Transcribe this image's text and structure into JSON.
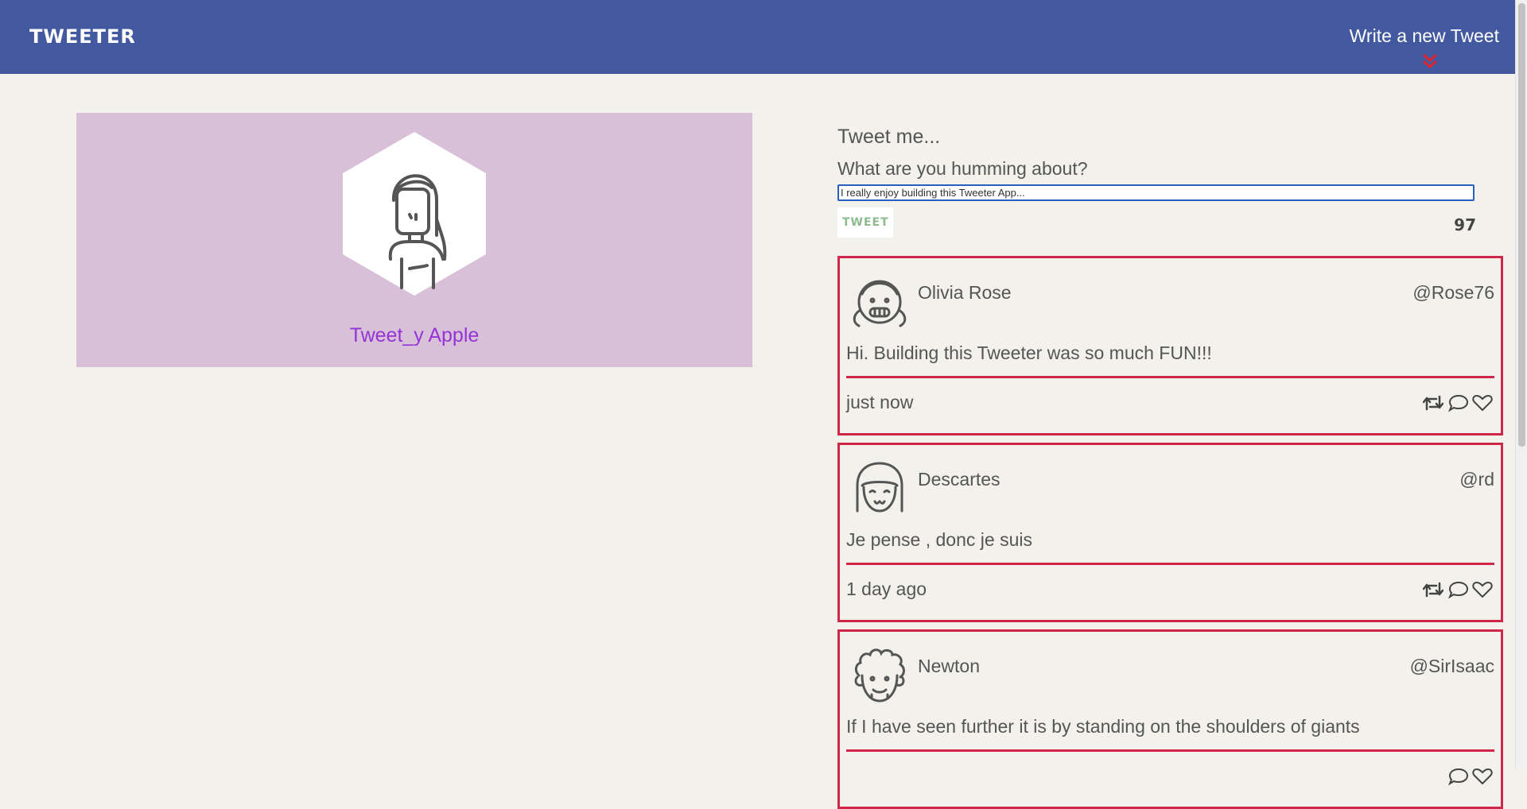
{
  "nav": {
    "brand": "TWEETER",
    "compose_toggle": "Write a new Tweet",
    "compose_toggle_icon": "double-chevron-down-icon",
    "accent_color": "#4259a0",
    "chevron_color": "#e0242f"
  },
  "profile": {
    "name": "Tweet_y Apple",
    "avatar_icon": "woman-avatar-icon",
    "background_color": "#d8c0d8",
    "name_color": "#9533d6"
  },
  "compose": {
    "title": "Tweet me...",
    "label": "What are you humming about?",
    "input_value": "I really enjoy building this Tweeter App...",
    "button_label": "TWEET",
    "counter": "97"
  },
  "tweets": [
    {
      "name": "Olivia Rose",
      "handle": "@Rose76",
      "text": "Hi. Building this Tweeter was so much FUN!!!",
      "time": "just now",
      "avatar_icon": "girl-pigtails-avatar-icon"
    },
    {
      "name": "Descartes",
      "handle": "@rd",
      "text": "Je pense , donc je suis",
      "time": "1 day ago",
      "avatar_icon": "bob-hair-avatar-icon"
    },
    {
      "name": "Newton",
      "handle": "@SirIsaac",
      "text": "If I have seen further it is by standing on the shoulders of giants",
      "time": "",
      "avatar_icon": "curly-hair-avatar-icon"
    }
  ],
  "tweet_actions": [
    "retweet-icon",
    "comment-icon",
    "heart-icon"
  ],
  "tweet_border_color": "#d0264a"
}
